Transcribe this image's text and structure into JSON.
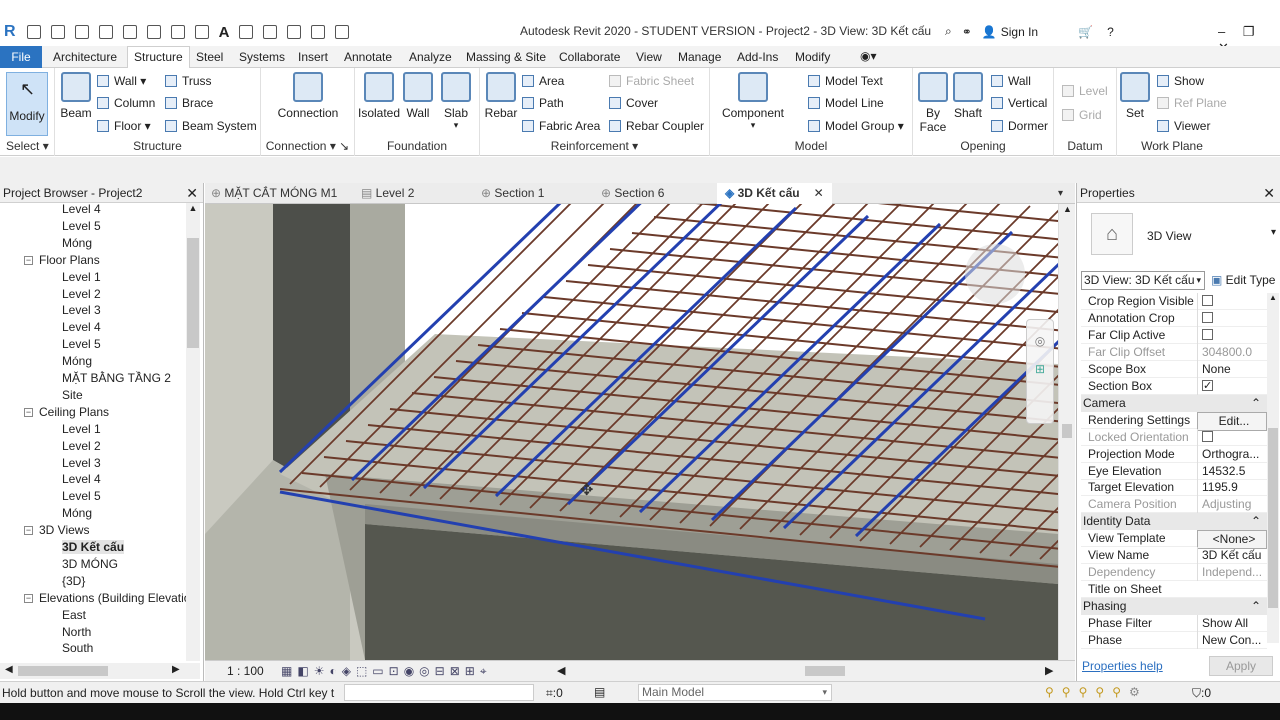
{
  "window": {
    "title": "Autodesk Revit 2020 - STUDENT VERSION - Project2 - 3D View: 3D Kết cấu",
    "sign_in": "Sign In"
  },
  "ribbon_tabs": [
    "File",
    "Architecture",
    "Structure",
    "Steel",
    "Systems",
    "Insert",
    "Annotate",
    "Analyze",
    "Massing & Site",
    "Collaborate",
    "View",
    "Manage",
    "Add-Ins",
    "Modify"
  ],
  "ribbon": {
    "modify": "Modify",
    "select_panel": "Select",
    "structure": {
      "title": "Structure",
      "beam": "Beam",
      "wall": "Wall",
      "column": "Column",
      "floor": "Floor",
      "truss": "Truss",
      "brace": "Brace",
      "beam_system": "Beam  System"
    },
    "connection": {
      "title": "Connection",
      "connection": "Connection"
    },
    "foundation": {
      "title": "Foundation",
      "isolated": "Isolated",
      "wall": "Wall",
      "slab": "Slab"
    },
    "reinforcement": {
      "title": "Reinforcement",
      "rebar": "Rebar",
      "area": "Area",
      "path": "Path",
      "fabric_area": "Fabric  Area",
      "fabric_sheet": "Fabric  Sheet",
      "cover": "Cover",
      "rebar_coupler": "Rebar  Coupler"
    },
    "model": {
      "title": "Model",
      "component": "Component",
      "model_text": "Model  Text",
      "model_line": "Model  Line",
      "model_group": "Model  Group"
    },
    "opening": {
      "title": "Opening",
      "by_face": "By Face",
      "shaft": "Shaft",
      "wall": "Wall",
      "vertical": "Vertical",
      "dormer": "Dormer"
    },
    "datum": {
      "title": "Datum",
      "level": "Level",
      "grid": "Grid"
    },
    "work_plane": {
      "title": "Work Plane",
      "set": "Set",
      "show": "Show",
      "ref_plane": "Ref  Plane",
      "viewer": "Viewer"
    }
  },
  "project_browser": {
    "title": "Project Browser - Project2",
    "rows": [
      {
        "label": "Level 4",
        "indent": 3
      },
      {
        "label": "Level 5",
        "indent": 3
      },
      {
        "label": "Móng",
        "indent": 3
      },
      {
        "label": "Floor Plans",
        "indent": 1,
        "group": true
      },
      {
        "label": "Level 1",
        "indent": 3
      },
      {
        "label": "Level 2",
        "indent": 3
      },
      {
        "label": "Level 3",
        "indent": 3
      },
      {
        "label": "Level 4",
        "indent": 3
      },
      {
        "label": "Level 5",
        "indent": 3
      },
      {
        "label": "Móng",
        "indent": 3
      },
      {
        "label": "MẶT BẰNG TẦNG 2",
        "indent": 3
      },
      {
        "label": "Site",
        "indent": 3
      },
      {
        "label": "Ceiling Plans",
        "indent": 1,
        "group": true
      },
      {
        "label": "Level 1",
        "indent": 3
      },
      {
        "label": "Level 2",
        "indent": 3
      },
      {
        "label": "Level 3",
        "indent": 3
      },
      {
        "label": "Level 4",
        "indent": 3
      },
      {
        "label": "Level 5",
        "indent": 3
      },
      {
        "label": "Móng",
        "indent": 3
      },
      {
        "label": "3D Views",
        "indent": 1,
        "group": true
      },
      {
        "label": "3D Kết cấu",
        "indent": 3,
        "selected": true
      },
      {
        "label": "3D MÓNG",
        "indent": 3
      },
      {
        "label": "{3D}",
        "indent": 3
      },
      {
        "label": "Elevations (Building Elevation)",
        "indent": 1,
        "group": true
      },
      {
        "label": "East",
        "indent": 3
      },
      {
        "label": "North",
        "indent": 3
      },
      {
        "label": "South",
        "indent": 3
      }
    ]
  },
  "view_tabs": [
    "MẶT CẮT MÓNG M1",
    "Level 2",
    "Section 1",
    "Section 6",
    "3D Kết cấu"
  ],
  "view_bar": {
    "scale": "1 : 100"
  },
  "properties": {
    "title": "Properties",
    "type_name": "3D View",
    "selector": "3D View: 3D Kết cấu",
    "edit_type": "Edit Type",
    "rows": [
      {
        "k": "Crop Region Visible",
        "cb": false
      },
      {
        "k": "Annotation Crop",
        "cb": false
      },
      {
        "k": "Far Clip Active",
        "cb": false
      },
      {
        "k": "Far Clip Offset",
        "v": "304800.0",
        "dim": true
      },
      {
        "k": "Scope Box",
        "v": "None"
      },
      {
        "k": "Section Box",
        "cb": true
      },
      {
        "section": "Camera"
      },
      {
        "k": "Rendering Settings",
        "v": "Edit..."
      },
      {
        "k": "Locked Orientation",
        "cb": false,
        "dim": true
      },
      {
        "k": "Projection Mode",
        "v": "Orthogra..."
      },
      {
        "k": "Eye Elevation",
        "v": "14532.5"
      },
      {
        "k": "Target Elevation",
        "v": "1195.9"
      },
      {
        "k": "Camera Position",
        "v": "Adjusting",
        "dim": true
      },
      {
        "section": "Identity Data"
      },
      {
        "k": "View Template",
        "v": "<None>"
      },
      {
        "k": "View Name",
        "v": "3D Kết cấu"
      },
      {
        "k": "Dependency",
        "v": "Independ...",
        "dim": true
      },
      {
        "k": "Title on Sheet",
        "v": ""
      },
      {
        "section": "Phasing"
      },
      {
        "k": "Phase Filter",
        "v": "Show All"
      },
      {
        "k": "Phase",
        "v": "New Con..."
      }
    ],
    "help": "Properties help",
    "apply": "Apply"
  },
  "status": {
    "text": "Hold button and move mouse to Scroll the view. Hold Ctrl key t",
    "sel_count": ":0",
    "model": "Main Model",
    "filter_count": ":0"
  },
  "colors": {
    "file_tab": "#2b73c1",
    "rebar_blue": "#2340b0",
    "rebar_brown": "#6b3a2a",
    "concrete": "#b8b8ae"
  }
}
